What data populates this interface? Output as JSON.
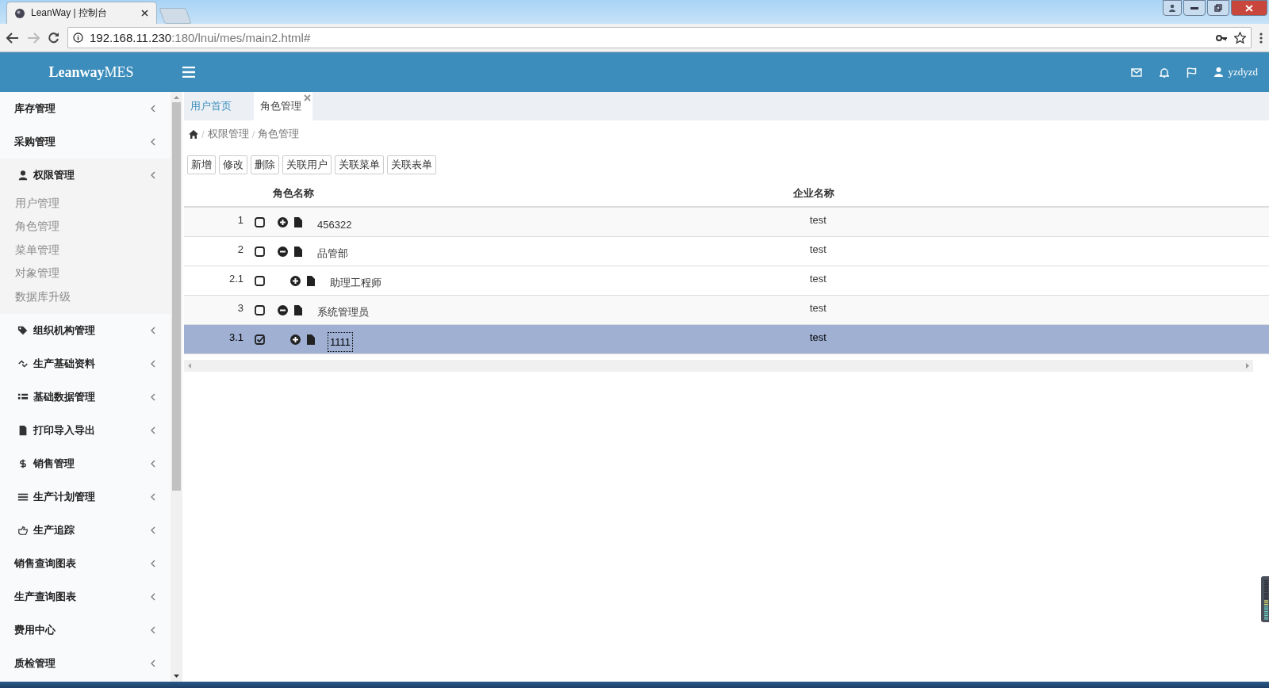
{
  "browser": {
    "tab_title": "LeanWay | 控制台",
    "url": {
      "host": "192.168.11.230",
      "path": ":180/lnui/mes/main2.html#"
    }
  },
  "header": {
    "logo_bold": "Leanway",
    "logo_light": "MES",
    "user": "yzdyzd"
  },
  "sidebar": {
    "items": [
      {
        "label": "库存管理"
      },
      {
        "label": "采购管理"
      },
      {
        "label": "权限管理",
        "children": [
          {
            "label": "用户管理"
          },
          {
            "label": "角色管理"
          },
          {
            "label": "菜单管理"
          },
          {
            "label": "对象管理"
          },
          {
            "label": "数据库升级"
          }
        ]
      },
      {
        "label": "组织机构管理"
      },
      {
        "label": "生产基础资料"
      },
      {
        "label": "基础数据管理"
      },
      {
        "label": "打印导入导出"
      },
      {
        "label": "销售管理"
      },
      {
        "label": "生产计划管理"
      },
      {
        "label": "生产追踪"
      },
      {
        "label": "销售查询图表"
      },
      {
        "label": "生产查询图表"
      },
      {
        "label": "费用中心"
      },
      {
        "label": "质检管理"
      }
    ]
  },
  "tabs": [
    {
      "label": "用户首页",
      "selected": false
    },
    {
      "label": "角色管理",
      "selected": true
    }
  ],
  "breadcrumb": {
    "separator": "/",
    "items": [
      "权限管理",
      "角色管理"
    ]
  },
  "toolbar": [
    "新增",
    "修改",
    "删除",
    "关联用户",
    "关联菜单",
    "关联表单"
  ],
  "table": {
    "columns": [
      "角色名称",
      "企业名称"
    ],
    "rows": [
      {
        "number": "1",
        "checked": false,
        "selected": false,
        "expanded": false,
        "name": "456322",
        "company": "test"
      },
      {
        "number": "2",
        "checked": false,
        "selected": false,
        "expanded": true,
        "name": "品管部",
        "company": "test",
        "children": [
          {
            "number": "2.1",
            "checked": false,
            "selected": false,
            "expanded": false,
            "name": "助理工程师",
            "company": "test"
          }
        ]
      },
      {
        "number": "3",
        "checked": false,
        "selected": false,
        "expanded": true,
        "name": "系统管理员",
        "company": "test",
        "children": [
          {
            "number": "3.1",
            "checked": true,
            "selected": true,
            "expanded": false,
            "name": "1111",
            "company": "test"
          }
        ]
      }
    ]
  }
}
